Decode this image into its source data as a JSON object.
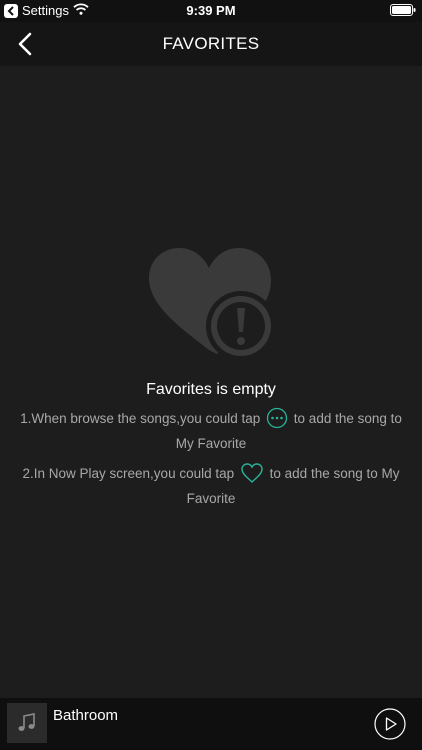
{
  "status_bar": {
    "back_app": "Settings",
    "time": "9:39 PM",
    "icons": [
      "back-arrow-icon",
      "wifi-icon",
      "battery-icon"
    ]
  },
  "nav": {
    "title": "FAVORITES",
    "back_icon": "chevron-left-icon"
  },
  "empty_state": {
    "icon": "heart-alert-icon",
    "title": "Favorites is empty",
    "hint1_before": "1.When browse the songs,you could tap",
    "hint1_icon": "more-dots-icon",
    "hint1_after": "to add the song to My Favorite",
    "hint2_before": "2.In Now Play screen,you could tap",
    "hint2_icon": "heart-outline-icon",
    "hint2_after": "to add the song to My Favorite"
  },
  "player": {
    "track_title": "Bathroom",
    "art_icon": "music-note-icon",
    "play_icon": "play-icon"
  },
  "colors": {
    "background": "#1d1d1d",
    "nav_background": "#151515",
    "player_background": "#0f0f0f",
    "illustration": "#3a3a3a",
    "accent": "#2ab39a",
    "hint_text": "#a8a8a8"
  }
}
